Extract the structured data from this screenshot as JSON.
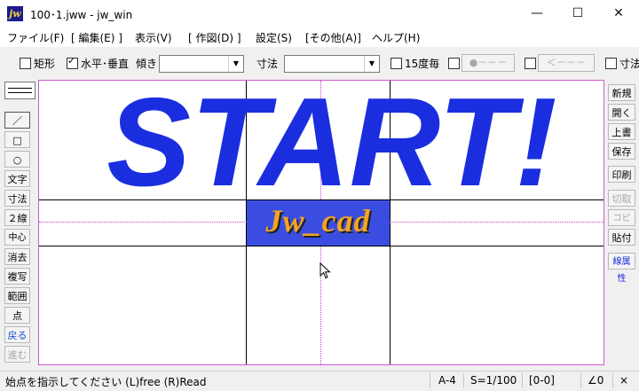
{
  "window": {
    "app_icon_text": "jw",
    "title": "100･1.jww - jw_win",
    "minimize": "—",
    "maximize": "☐",
    "close": "✕"
  },
  "menu": [
    "ファイル(F)",
    "[ 編集(E) ]",
    "表示(V)",
    "[ 作図(D) ]",
    "設定(S)",
    "[その他(A)]",
    "ヘルプ(H)"
  ],
  "toolbar": {
    "rectangle_label": "矩形",
    "rectangle_checked": false,
    "horizontal_vertical_label": "水平･垂直",
    "horizontal_vertical_checked": true,
    "tilt_label": "傾き",
    "tilt_value": "",
    "dimension_label": "寸法",
    "dimension_value": "",
    "deg15_label": "15度毎",
    "deg15_checked": false,
    "dot_button_label": "●－－－",
    "arrow_button_label": "＜－－－",
    "dim_right_label": "寸法"
  },
  "left_tools": [
    "／",
    "□",
    "○",
    "文字",
    "寸法",
    "２線",
    "中心線",
    "消去",
    "複写",
    "範囲",
    "点",
    "戻る",
    "進む"
  ],
  "right_tools": [
    "新規",
    "開く",
    "上書",
    "保存",
    "印刷",
    "切取",
    "コピー",
    "貼付",
    "線属性"
  ],
  "drawing": {
    "headline": "START!",
    "logo_text": "Jw_cad",
    "headline_color": "#1a2ee0",
    "logo_bg_color": "#3b4de0",
    "logo_text_color": "#f4a51c"
  },
  "status": {
    "message": "始点を指示してください (L)free (R)Read",
    "paper": "A-4",
    "scale": "S=1/100",
    "layer": "[0-0]",
    "angle": "∠0",
    "arrow": "×"
  }
}
